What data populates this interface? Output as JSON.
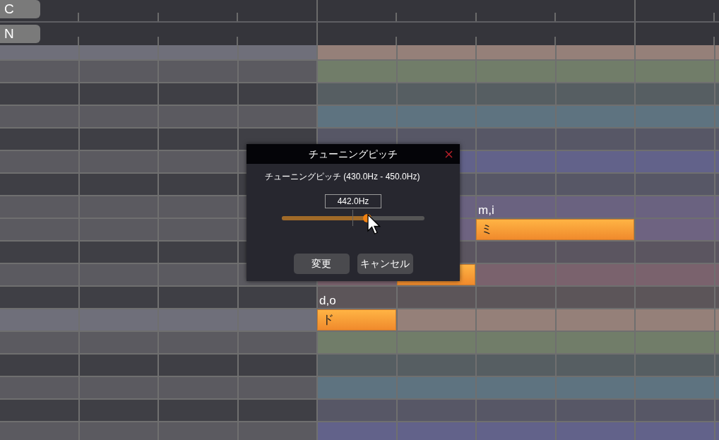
{
  "header_buttons": [
    {
      "label": "C"
    },
    {
      "label": "N"
    }
  ],
  "rows": [
    {
      "kind": "c",
      "color": "#958079",
      "cells": [
        {
          "kind": "blank"
        },
        {
          "kind": "blank"
        },
        {
          "kind": "blank"
        },
        {
          "kind": "blank"
        },
        {
          "kind": "blank"
        },
        {
          "kind": "blank"
        },
        {
          "kind": "blank"
        },
        {
          "kind": "blank"
        },
        {
          "kind": "blank"
        },
        {
          "kind": "blank"
        }
      ]
    },
    {
      "kind": "white",
      "color": "#717d69",
      "cells": [
        {
          "kind": "blank"
        },
        {
          "kind": "blank"
        },
        {
          "kind": "blank"
        },
        {
          "kind": "blank"
        },
        {
          "kind": "blank"
        },
        {
          "kind": "blank"
        },
        {
          "kind": "blank"
        },
        {
          "kind": "blank"
        },
        {
          "kind": "blank"
        },
        {
          "kind": "blank"
        }
      ]
    },
    {
      "kind": "black",
      "color": "#565e62",
      "cells": [
        {
          "kind": "blank"
        },
        {
          "kind": "blank"
        },
        {
          "kind": "blank"
        },
        {
          "kind": "blank"
        },
        {
          "kind": "blank"
        },
        {
          "kind": "blank"
        },
        {
          "kind": "blank"
        },
        {
          "kind": "blank"
        },
        {
          "kind": "blank"
        },
        {
          "kind": "blank"
        }
      ]
    },
    {
      "kind": "white",
      "color": "#5e7380",
      "cells": [
        {
          "kind": "blank"
        },
        {
          "kind": "blank"
        },
        {
          "kind": "blank"
        },
        {
          "kind": "blank"
        },
        {
          "kind": "blank"
        },
        {
          "kind": "blank"
        },
        {
          "kind": "blank"
        },
        {
          "kind": "blank"
        },
        {
          "kind": "blank"
        },
        {
          "kind": "blank"
        }
      ]
    },
    {
      "kind": "black",
      "color": "#575766",
      "cells": [
        {
          "kind": "blank"
        },
        {
          "kind": "blank"
        },
        {
          "kind": "blank"
        },
        {
          "kind": "blank"
        },
        {
          "kind": "blank"
        },
        {
          "kind": "blank"
        },
        {
          "kind": "blank"
        },
        {
          "kind": "blank"
        },
        {
          "kind": "blank"
        },
        {
          "kind": "blank"
        }
      ]
    },
    {
      "kind": "white",
      "color": "#62628a",
      "cells": [
        {
          "kind": "blank"
        },
        {
          "kind": "blank"
        },
        {
          "kind": "blank"
        },
        {
          "kind": "blank"
        },
        {
          "kind": "blank"
        },
        {
          "kind": "blank"
        },
        {
          "kind": "blank"
        },
        {
          "kind": "blank"
        },
        {
          "kind": "blank"
        },
        {
          "kind": "blank"
        }
      ]
    },
    {
      "kind": "black",
      "color": "#575766",
      "cells": [
        {
          "kind": "blank"
        },
        {
          "kind": "blank"
        },
        {
          "kind": "blank"
        },
        {
          "kind": "blank"
        },
        {
          "kind": "blank"
        },
        {
          "kind": "blank"
        },
        {
          "kind": "blank"
        },
        {
          "kind": "blank"
        },
        {
          "kind": "blank"
        },
        {
          "kind": "blank"
        }
      ]
    },
    {
      "kind": "white",
      "color": "#6a6280",
      "cells": [
        {
          "kind": "blank"
        },
        {
          "kind": "blank"
        },
        {
          "kind": "blank"
        },
        {
          "kind": "blank"
        },
        {
          "kind": "blank"
        },
        {
          "kind": "blank"
        },
        {
          "kind": "blank"
        },
        {
          "kind": "blank"
        },
        {
          "kind": "blank"
        },
        {
          "kind": "blank"
        }
      ]
    },
    {
      "kind": "white",
      "color": "#6e6381",
      "cells": [
        {
          "kind": "blank"
        },
        {
          "kind": "blank"
        },
        {
          "kind": "blank"
        },
        {
          "kind": "blank"
        },
        {
          "kind": "blank"
        },
        {
          "kind": "blank"
        },
        {
          "kind": "note",
          "lyric": "ミ",
          "romaji": "m,i"
        },
        {
          "kind": "note_tail"
        },
        {
          "kind": "blank"
        },
        {
          "kind": "blank"
        }
      ]
    },
    {
      "kind": "black",
      "color": "#5b5560",
      "cells": [
        {
          "kind": "blank"
        },
        {
          "kind": "blank"
        },
        {
          "kind": "blank"
        },
        {
          "kind": "blank"
        },
        {
          "kind": "blank"
        },
        {
          "kind": "blank"
        },
        {
          "kind": "blank"
        },
        {
          "kind": "blank"
        },
        {
          "kind": "blank"
        },
        {
          "kind": "blank"
        }
      ]
    },
    {
      "kind": "white",
      "color": "#7a626d",
      "cells": [
        {
          "kind": "blank"
        },
        {
          "kind": "blank"
        },
        {
          "kind": "blank"
        },
        {
          "kind": "blank"
        },
        {
          "kind": "blank"
        },
        {
          "kind": "note"
        },
        {
          "kind": "blank"
        },
        {
          "kind": "blank"
        },
        {
          "kind": "blank"
        },
        {
          "kind": "blank"
        }
      ]
    },
    {
      "kind": "black",
      "color": "#5c5559",
      "cells": [
        {
          "kind": "blank"
        },
        {
          "kind": "blank"
        },
        {
          "kind": "blank"
        },
        {
          "kind": "blank"
        },
        {
          "kind": "blank"
        },
        {
          "kind": "blank"
        },
        {
          "kind": "blank"
        },
        {
          "kind": "blank"
        },
        {
          "kind": "blank"
        },
        {
          "kind": "blank"
        }
      ]
    },
    {
      "kind": "c",
      "color": "#958079",
      "cells": [
        {
          "kind": "blank"
        },
        {
          "kind": "blank"
        },
        {
          "kind": "blank"
        },
        {
          "kind": "blank"
        },
        {
          "kind": "note",
          "lyric": "ド",
          "romaji": "d,o"
        },
        {
          "kind": "blank"
        },
        {
          "kind": "blank"
        },
        {
          "kind": "blank"
        },
        {
          "kind": "blank"
        },
        {
          "kind": "blank"
        }
      ]
    },
    {
      "kind": "white",
      "color": "#717d69",
      "cells": [
        {
          "kind": "blank"
        },
        {
          "kind": "blank"
        },
        {
          "kind": "blank"
        },
        {
          "kind": "blank"
        },
        {
          "kind": "blank"
        },
        {
          "kind": "blank"
        },
        {
          "kind": "blank"
        },
        {
          "kind": "blank"
        },
        {
          "kind": "blank"
        },
        {
          "kind": "blank"
        }
      ]
    },
    {
      "kind": "black",
      "color": "#565e62",
      "cells": [
        {
          "kind": "blank"
        },
        {
          "kind": "blank"
        },
        {
          "kind": "blank"
        },
        {
          "kind": "blank"
        },
        {
          "kind": "blank"
        },
        {
          "kind": "blank"
        },
        {
          "kind": "blank"
        },
        {
          "kind": "blank"
        },
        {
          "kind": "blank"
        },
        {
          "kind": "blank"
        }
      ]
    },
    {
      "kind": "white",
      "color": "#5e7380",
      "cells": [
        {
          "kind": "blank"
        },
        {
          "kind": "blank"
        },
        {
          "kind": "blank"
        },
        {
          "kind": "blank"
        },
        {
          "kind": "blank"
        },
        {
          "kind": "blank"
        },
        {
          "kind": "blank"
        },
        {
          "kind": "blank"
        },
        {
          "kind": "blank"
        },
        {
          "kind": "blank"
        }
      ]
    },
    {
      "kind": "black",
      "color": "#575766",
      "cells": [
        {
          "kind": "blank"
        },
        {
          "kind": "blank"
        },
        {
          "kind": "blank"
        },
        {
          "kind": "blank"
        },
        {
          "kind": "blank"
        },
        {
          "kind": "blank"
        },
        {
          "kind": "blank"
        },
        {
          "kind": "blank"
        },
        {
          "kind": "blank"
        },
        {
          "kind": "blank"
        }
      ]
    },
    {
      "kind": "white",
      "color": "#62628a",
      "cells": [
        {
          "kind": "blank"
        },
        {
          "kind": "blank"
        },
        {
          "kind": "blank"
        },
        {
          "kind": "blank"
        },
        {
          "kind": "blank"
        },
        {
          "kind": "blank"
        },
        {
          "kind": "blank"
        },
        {
          "kind": "blank"
        },
        {
          "kind": "blank"
        },
        {
          "kind": "blank"
        }
      ]
    }
  ],
  "dialog": {
    "title": "チューニングピッチ",
    "label": "チューニングピッチ (430.0Hz - 450.0Hz)",
    "value": "442.0Hz",
    "slider": {
      "level": 0.6
    },
    "buttons": [
      {
        "label": "変更"
      },
      {
        "label": "キャンセル"
      }
    ]
  }
}
